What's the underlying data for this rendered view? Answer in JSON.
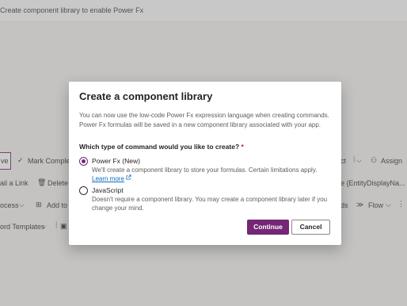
{
  "app": {
    "breadcrumb": "Create component library to enable Power Fx"
  },
  "commands": {
    "row1": {
      "save": "ve",
      "mark_complete": "Mark Complet",
      "ct": "ct",
      "assign": "Assign"
    },
    "row2": {
      "email_link": "ail a Link",
      "delete": "Delete",
      "display_name": "e {EntityDisplayNa..."
    },
    "row3": {
      "process": "ocess",
      "add_to": "Add to",
      "ds": "ds",
      "flow": "Flow"
    },
    "row4": {
      "word_templates": "ord Templates"
    }
  },
  "dialog": {
    "title": "Create a component library",
    "description": "You can now use the low-code Power Fx expression language when creating commands. Power Fx formulas will be saved in a new component library associated with your app.",
    "question": "Which type of command would you like to create?",
    "required_marker": "*",
    "options": [
      {
        "label": "Power Fx (New)",
        "description": "We'll create a component library to store your formulas. Certain limitations apply.",
        "link": "Learn more",
        "selected": true
      },
      {
        "label": "JavaScript",
        "description": "Doesn't require a component library. You may create a component library later if you change your mind.",
        "selected": false
      }
    ],
    "continue_label": "Continue",
    "cancel_label": "Cancel"
  },
  "colors": {
    "accent": "#742774",
    "link": "#0f6cbd"
  }
}
